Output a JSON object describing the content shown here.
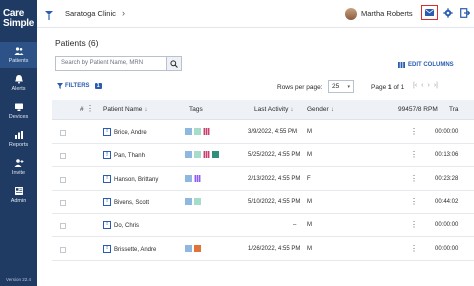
{
  "app": {
    "logo_line1": "Care",
    "logo_line2": "Simple",
    "version": "Version 22.4"
  },
  "sidebar": {
    "items": [
      {
        "label": "Patients",
        "icon": "patients-icon",
        "active": true
      },
      {
        "label": "Alerts",
        "icon": "bell-icon",
        "active": false
      },
      {
        "label": "Devices",
        "icon": "devices-icon",
        "active": false
      },
      {
        "label": "Reports",
        "icon": "reports-icon",
        "active": false
      },
      {
        "label": "Invite",
        "icon": "invite-icon",
        "active": false
      },
      {
        "label": "Admin",
        "icon": "admin-icon",
        "active": false
      }
    ]
  },
  "header": {
    "clinic": "Saratoga Clinic",
    "user_name": "Martha Roberts"
  },
  "main": {
    "title": "Patients (6)",
    "search_placeholder": "Search by Patient Name, MRN",
    "edit_columns": "EDIT COLUMNS",
    "filters_label": "FILTERS",
    "filters_count": "1",
    "rows_per_page_label": "Rows per page:",
    "rows_per_page_value": "25",
    "page_label": "Page",
    "page_current": "1",
    "page_of": "of 1"
  },
  "table": {
    "headers": {
      "num": "#",
      "patient_name": "Patient Name",
      "tags": "Tags",
      "last_activity": "Last Activity",
      "gender": "Gender",
      "rpm": "99457/8 RPM",
      "tra": "Tra"
    },
    "rows": [
      {
        "name": "Brice, Andre",
        "last_activity": "3/9/2022, 4:55 PM",
        "gender": "M",
        "rpm": "00:00:00",
        "tags": [
          "#8fb8e0",
          "#a6dccc",
          "#c9406e"
        ]
      },
      {
        "name": "Pan, Thanh",
        "last_activity": "5/25/2022, 4:55 PM",
        "gender": "M",
        "rpm": "00:13:06",
        "tags": [
          "#8fb8e0",
          "#a6dccc",
          "#c9406e",
          "#2f8f7a"
        ]
      },
      {
        "name": "Hanson, Brittany",
        "last_activity": "2/13/2022, 4:55 PM",
        "gender": "F",
        "rpm": "00:23:28",
        "tags": [
          "#8fb8e0",
          "#8b5cf6"
        ]
      },
      {
        "name": "Bivens, Scott",
        "last_activity": "5/10/2022, 4:55 PM",
        "gender": "M",
        "rpm": "00:44:02",
        "tags": [
          "#8fb8e0",
          "#a6dccc"
        ]
      },
      {
        "name": "Do, Chris",
        "last_activity": "–",
        "gender": "M",
        "rpm": "00:00:00",
        "tags": []
      },
      {
        "name": "Brissette, Andre",
        "last_activity": "1/26/2022, 4:55 PM",
        "gender": "M",
        "rpm": "00:00:00",
        "tags": [
          "#8fb8e0",
          "#e0733a"
        ]
      }
    ]
  }
}
